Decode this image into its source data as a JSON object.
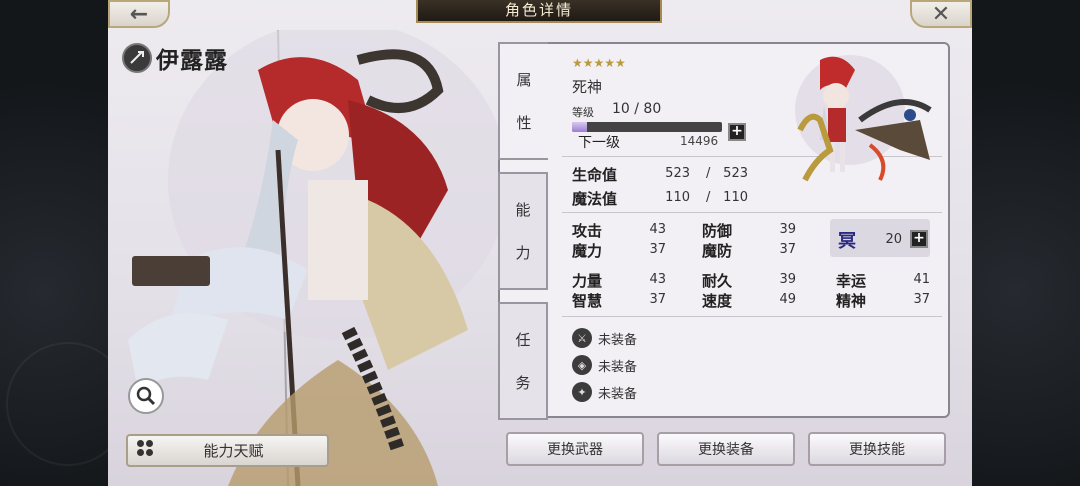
{
  "header": {
    "title": "角色详情",
    "back_icon": "←",
    "close_icon": "✕"
  },
  "character": {
    "name": "伊露露",
    "stars": "★★★★★",
    "class": "死神"
  },
  "level": {
    "label": "等级",
    "value": "10 / 80",
    "progress": 0.1,
    "next_label": "下一级",
    "next_value": "14496"
  },
  "tabs": [
    {
      "c1": "属",
      "c2": "性"
    },
    {
      "c1": "能",
      "c2": "力"
    },
    {
      "c1": "任",
      "c2": "务"
    }
  ],
  "vitals": [
    {
      "label": "生命值",
      "current": "523",
      "max": "523"
    },
    {
      "label": "魔法值",
      "current": "110",
      "max": "110"
    }
  ],
  "stats": {
    "atk": {
      "label": "攻击",
      "value": "43"
    },
    "def": {
      "label": "防御",
      "value": "39"
    },
    "mag": {
      "label": "魔力",
      "value": "37"
    },
    "mdef": {
      "label": "魔防",
      "value": "37"
    },
    "str": {
      "label": "力量",
      "value": "43"
    },
    "end": {
      "label": "耐久",
      "value": "39"
    },
    "luk": {
      "label": "幸运",
      "value": "41"
    },
    "int": {
      "label": "智慧",
      "value": "37"
    },
    "spd": {
      "label": "速度",
      "value": "49"
    },
    "spi": {
      "label": "精神",
      "value": "37"
    }
  },
  "element": {
    "icon": "冥",
    "value": "20"
  },
  "equipment": [
    {
      "label": "未装备",
      "icon": "weapon"
    },
    {
      "label": "未装备",
      "icon": "armor"
    },
    {
      "label": "未装备",
      "icon": "skill"
    }
  ],
  "buttons": {
    "talent": "能力天赋",
    "change_weapon": "更换武器",
    "change_equip": "更换装备",
    "change_skill": "更换技能"
  }
}
